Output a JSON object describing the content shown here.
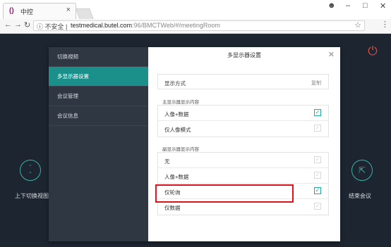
{
  "browser": {
    "tab_title": "中控",
    "tab_favicon": "()",
    "security_label": "不安全",
    "url_host": "testmedical.butel.com",
    "url_path": ":96/BMCTWeb/#/meetingRoom",
    "window_controls": [
      "account-icon",
      "minimize-icon",
      "maximize-icon",
      "close-icon"
    ]
  },
  "app": {
    "left_action_label": "上下切换视图",
    "right_action_label": "结束会议",
    "accent_color": "#1b8f8a",
    "power_color": "#e04a3e"
  },
  "dialog": {
    "title": "多显示器设置",
    "menu": [
      {
        "label": "切换視频",
        "active": false
      },
      {
        "label": "多显示器设置",
        "active": true
      },
      {
        "label": "会议管理",
        "active": false
      },
      {
        "label": "会议信息",
        "active": false
      }
    ],
    "display_mode": {
      "label": "显示方式",
      "value": "复制"
    },
    "primary_section": {
      "title": "主显示器显示内容",
      "options": [
        {
          "label": "人像+数据",
          "checked": true
        },
        {
          "label": "仅人像模式",
          "checked": false
        }
      ]
    },
    "secondary_section": {
      "title": "副显示器显示内容",
      "options": [
        {
          "label": "无",
          "checked": false
        },
        {
          "label": "人像+数据",
          "checked": false
        },
        {
          "label": "仅轮询",
          "checked": true
        },
        {
          "label": "仅数据",
          "checked": false
        }
      ]
    }
  }
}
